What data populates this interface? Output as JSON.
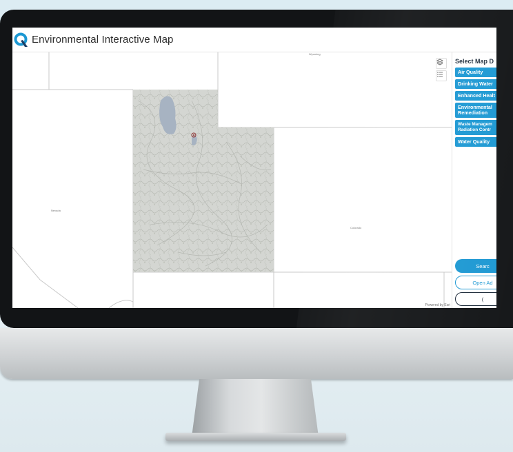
{
  "app": {
    "title": "Environmental Interactive Map"
  },
  "map": {
    "labels": {
      "wyoming": "Wyoming",
      "nevada": "Nevada",
      "colorado": "Colorado"
    },
    "attribution": "Powered by Esri",
    "tools": [
      {
        "icon": "layers-icon"
      },
      {
        "icon": "legend-icon"
      }
    ]
  },
  "panel": {
    "title": "Select Map D",
    "layers": [
      {
        "label": "Air Quality"
      },
      {
        "label": "Drinking Water"
      },
      {
        "label": "Enhanced Healt"
      },
      {
        "label_line1": "Environmental",
        "label_line2": "Remediation"
      },
      {
        "label_line1": "Waste Managem",
        "label_line2": "Radiation Contr"
      },
      {
        "label": "Water Quality"
      }
    ],
    "actions": {
      "search": "Searc",
      "open": "Open Ad",
      "third": "("
    }
  },
  "colors": {
    "accent": "#1c98d3",
    "bezel": "#121416",
    "background": "#dcecf3"
  }
}
